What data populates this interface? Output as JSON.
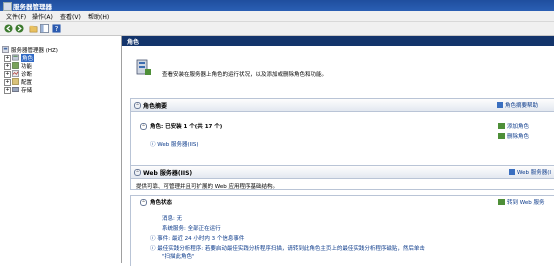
{
  "window": {
    "title": "服务器管理器"
  },
  "menu": [
    "文件(F)",
    "操作(A)",
    "查看(V)",
    "帮助(H)"
  ],
  "tree": {
    "root": "服务器管理器 (HZ)",
    "items": [
      "角色",
      "功能",
      "诊断",
      "配置",
      "存储"
    ],
    "selected": "角色"
  },
  "pane": {
    "header": "角色",
    "intro": "查看安装在服务器上角色的运行状况，以及添加或删除角色和功能。"
  },
  "summary": {
    "title": "角色摘要",
    "help": "角色摘要帮助",
    "roles_line": "角色: 已安装 1 个(共 17 个)",
    "role_link": "Web 服务器(IIS)",
    "add": "添加角色",
    "remove": "删除角色"
  },
  "web": {
    "title": "Web 服务器(IIS)",
    "help": "Web 服务器(I",
    "description": "提供可靠、可管理并且可扩展的 Web 应用程序基础结构。",
    "status_title": "角色状态",
    "goto": "转到 Web 服务",
    "messages": "消息: 无",
    "services": "系统服务: 全部正在运行",
    "events": "事件: 最近 24 小时内 3 个信息事件",
    "bpa": "最佳实践分析程序: 若要启动最佳实践分析程序扫描，请转到此角色主页上的最佳实践分析程序磁贴，然后单击",
    "bpa2": "\"扫描此角色\""
  },
  "colors": {
    "titlebar": "#1f4e9e",
    "pane_header": "#13346b",
    "link": "#0b3a8a",
    "selection": "#316ac5"
  }
}
